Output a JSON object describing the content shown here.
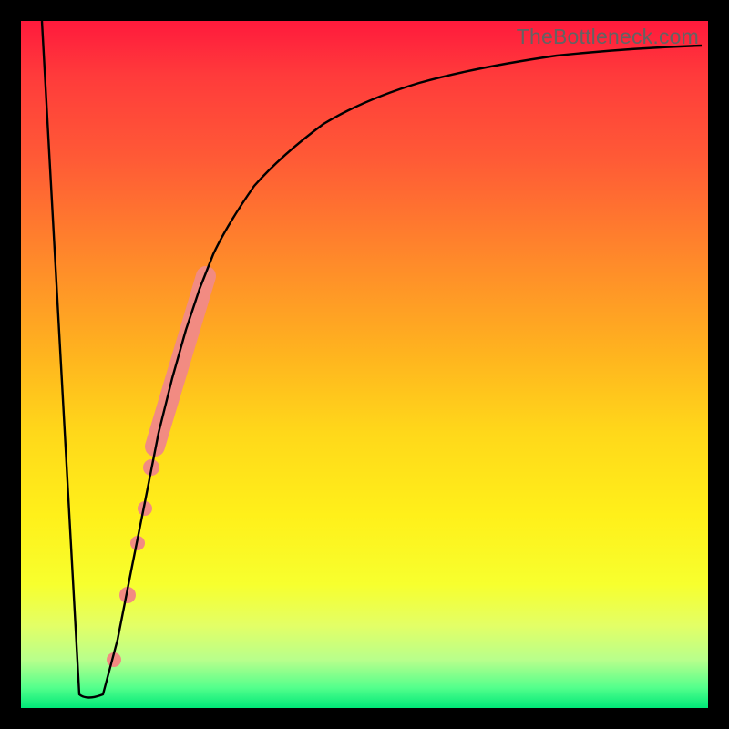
{
  "watermark": "TheBottleneck.com",
  "chart_data": {
    "type": "line",
    "title": "",
    "xlabel": "",
    "ylabel": "",
    "xlim": [
      0,
      100
    ],
    "ylim": [
      0,
      100
    ],
    "grid": false,
    "legend": false,
    "gradient_stops": [
      {
        "pos": 0,
        "color": "#ff1a3c"
      },
      {
        "pos": 8,
        "color": "#ff3b3b"
      },
      {
        "pos": 20,
        "color": "#ff5a36"
      },
      {
        "pos": 35,
        "color": "#ff8a2a"
      },
      {
        "pos": 48,
        "color": "#ffb21f"
      },
      {
        "pos": 60,
        "color": "#ffd81a"
      },
      {
        "pos": 72,
        "color": "#fff01a"
      },
      {
        "pos": 82,
        "color": "#f7ff2e"
      },
      {
        "pos": 88,
        "color": "#e3ff66"
      },
      {
        "pos": 93,
        "color": "#b8ff8c"
      },
      {
        "pos": 97,
        "color": "#55ff8c"
      },
      {
        "pos": 100,
        "color": "#00e878"
      }
    ],
    "series": [
      {
        "name": "bottleneck-curve",
        "color": "#000000",
        "stroke_width": 2.2,
        "x": [
          3,
          8.5,
          9.5,
          12,
          14,
          16,
          18,
          20,
          22,
          24,
          26,
          28,
          30,
          34,
          38,
          44,
          50,
          58,
          66,
          76,
          88,
          99
        ],
        "y": [
          100,
          2,
          2,
          2,
          10,
          20,
          30,
          40,
          48,
          55,
          61,
          66,
          70,
          76,
          80.5,
          85,
          88,
          90.5,
          92.3,
          93.7,
          94.8,
          95.5
        ]
      }
    ],
    "highlight_segment": {
      "name": "highlight-band",
      "color": "#f28b82",
      "stroke_width": 12,
      "x_range": [
        19.5,
        27
      ],
      "y_range": [
        38,
        63
      ]
    },
    "highlight_dots": {
      "name": "highlight-dots",
      "color": "#f28b82",
      "radius": 8,
      "points": [
        {
          "x": 19,
          "y": 35
        },
        {
          "x": 18,
          "y": 29
        },
        {
          "x": 17,
          "y": 24
        },
        {
          "x": 15.5,
          "y": 16.5
        },
        {
          "x": 13.5,
          "y": 7
        }
      ]
    }
  }
}
